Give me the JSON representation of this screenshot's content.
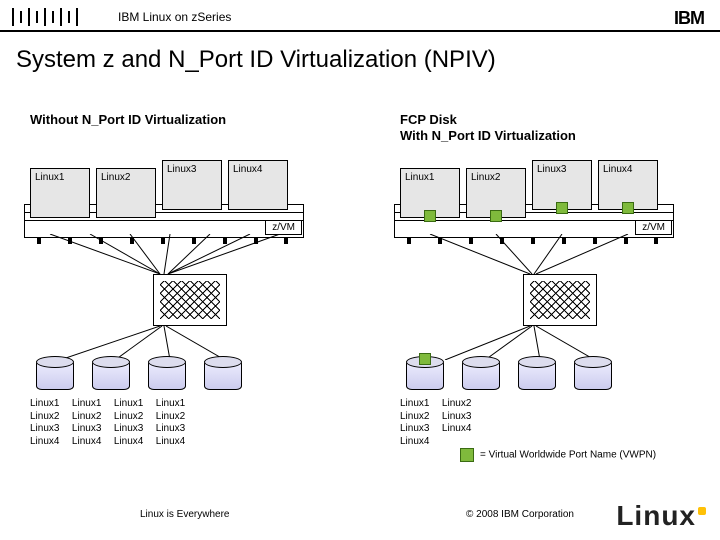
{
  "header": {
    "breadcrumb": "IBM Linux on zSeries",
    "brand": "IBM"
  },
  "title": "System z and N_Port ID Virtualization (NPIV)",
  "left_panel": {
    "caption": "Without N_Port ID Virtualization",
    "guests": [
      "Linux1",
      "Linux2",
      "Linux3",
      "Linux4"
    ],
    "hypervisor": "z/VM",
    "disk_assign": {
      "columns": [
        [
          "Linux1",
          "Linux2",
          "Linux3",
          "Linux4"
        ],
        [
          "Linux1",
          "Linux2",
          "Linux3",
          "Linux4"
        ],
        [
          "Linux1",
          "Linux2",
          "Linux3",
          "Linux4"
        ],
        [
          "Linux1",
          "Linux2",
          "Linux3",
          "Linux4"
        ]
      ]
    }
  },
  "right_panel": {
    "caption_line1": "FCP Disk",
    "caption_line2": "With N_Port ID Virtualization",
    "guests": [
      "Linux1",
      "Linux2",
      "Linux3",
      "Linux4"
    ],
    "hypervisor": "z/VM",
    "disk_assign_left": [
      "Linux1",
      "Linux2",
      "Linux3",
      "Linux4"
    ],
    "disk_assign_right": [
      "Linux2",
      "Linux3",
      "Linux4"
    ]
  },
  "legend": "= Virtual Worldwide Port Name (VWPN)",
  "footer": {
    "left": "Linux is Everywhere",
    "right": "© 2008 IBM Corporation",
    "logo": "Linux"
  }
}
